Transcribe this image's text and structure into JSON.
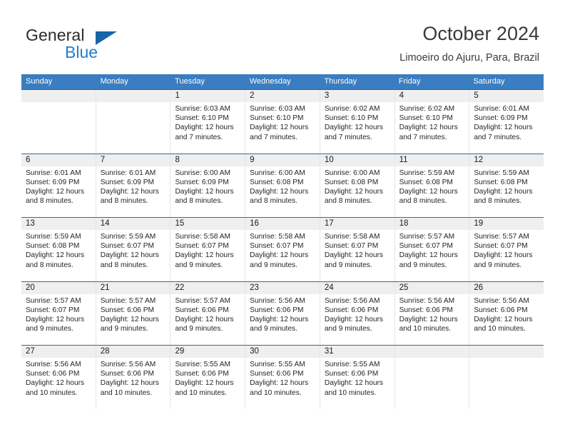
{
  "brand": {
    "word_one": "General",
    "word_two": "Blue",
    "triangle_icon": "triangle-icon",
    "accent_dark": "#1565a8",
    "accent_light": "#1c7fd0"
  },
  "header": {
    "month_title": "October 2024",
    "location": "Limoeiro do Ajuru, Para, Brazil"
  },
  "theme": {
    "header_row_bg": "#3a7dc0",
    "week_divider": "#2d6aa8",
    "day_band_bg": "#efefef",
    "cell_border": "#e6e6e6"
  },
  "weekdays": [
    "Sunday",
    "Monday",
    "Tuesday",
    "Wednesday",
    "Thursday",
    "Friday",
    "Saturday"
  ],
  "weeks": [
    [
      {
        "day": "",
        "empty": true
      },
      {
        "day": "",
        "empty": true
      },
      {
        "day": "1",
        "sunrise": "Sunrise: 6:03 AM",
        "sunset": "Sunset: 6:10 PM",
        "daylight": "Daylight: 12 hours and 7 minutes."
      },
      {
        "day": "2",
        "sunrise": "Sunrise: 6:03 AM",
        "sunset": "Sunset: 6:10 PM",
        "daylight": "Daylight: 12 hours and 7 minutes."
      },
      {
        "day": "3",
        "sunrise": "Sunrise: 6:02 AM",
        "sunset": "Sunset: 6:10 PM",
        "daylight": "Daylight: 12 hours and 7 minutes."
      },
      {
        "day": "4",
        "sunrise": "Sunrise: 6:02 AM",
        "sunset": "Sunset: 6:10 PM",
        "daylight": "Daylight: 12 hours and 7 minutes."
      },
      {
        "day": "5",
        "sunrise": "Sunrise: 6:01 AM",
        "sunset": "Sunset: 6:09 PM",
        "daylight": "Daylight: 12 hours and 7 minutes."
      }
    ],
    [
      {
        "day": "6",
        "sunrise": "Sunrise: 6:01 AM",
        "sunset": "Sunset: 6:09 PM",
        "daylight": "Daylight: 12 hours and 8 minutes."
      },
      {
        "day": "7",
        "sunrise": "Sunrise: 6:01 AM",
        "sunset": "Sunset: 6:09 PM",
        "daylight": "Daylight: 12 hours and 8 minutes."
      },
      {
        "day": "8",
        "sunrise": "Sunrise: 6:00 AM",
        "sunset": "Sunset: 6:09 PM",
        "daylight": "Daylight: 12 hours and 8 minutes."
      },
      {
        "day": "9",
        "sunrise": "Sunrise: 6:00 AM",
        "sunset": "Sunset: 6:08 PM",
        "daylight": "Daylight: 12 hours and 8 minutes."
      },
      {
        "day": "10",
        "sunrise": "Sunrise: 6:00 AM",
        "sunset": "Sunset: 6:08 PM",
        "daylight": "Daylight: 12 hours and 8 minutes."
      },
      {
        "day": "11",
        "sunrise": "Sunrise: 5:59 AM",
        "sunset": "Sunset: 6:08 PM",
        "daylight": "Daylight: 12 hours and 8 minutes."
      },
      {
        "day": "12",
        "sunrise": "Sunrise: 5:59 AM",
        "sunset": "Sunset: 6:08 PM",
        "daylight": "Daylight: 12 hours and 8 minutes."
      }
    ],
    [
      {
        "day": "13",
        "sunrise": "Sunrise: 5:59 AM",
        "sunset": "Sunset: 6:08 PM",
        "daylight": "Daylight: 12 hours and 8 minutes."
      },
      {
        "day": "14",
        "sunrise": "Sunrise: 5:59 AM",
        "sunset": "Sunset: 6:07 PM",
        "daylight": "Daylight: 12 hours and 8 minutes."
      },
      {
        "day": "15",
        "sunrise": "Sunrise: 5:58 AM",
        "sunset": "Sunset: 6:07 PM",
        "daylight": "Daylight: 12 hours and 9 minutes."
      },
      {
        "day": "16",
        "sunrise": "Sunrise: 5:58 AM",
        "sunset": "Sunset: 6:07 PM",
        "daylight": "Daylight: 12 hours and 9 minutes."
      },
      {
        "day": "17",
        "sunrise": "Sunrise: 5:58 AM",
        "sunset": "Sunset: 6:07 PM",
        "daylight": "Daylight: 12 hours and 9 minutes."
      },
      {
        "day": "18",
        "sunrise": "Sunrise: 5:57 AM",
        "sunset": "Sunset: 6:07 PM",
        "daylight": "Daylight: 12 hours and 9 minutes."
      },
      {
        "day": "19",
        "sunrise": "Sunrise: 5:57 AM",
        "sunset": "Sunset: 6:07 PM",
        "daylight": "Daylight: 12 hours and 9 minutes."
      }
    ],
    [
      {
        "day": "20",
        "sunrise": "Sunrise: 5:57 AM",
        "sunset": "Sunset: 6:07 PM",
        "daylight": "Daylight: 12 hours and 9 minutes."
      },
      {
        "day": "21",
        "sunrise": "Sunrise: 5:57 AM",
        "sunset": "Sunset: 6:06 PM",
        "daylight": "Daylight: 12 hours and 9 minutes."
      },
      {
        "day": "22",
        "sunrise": "Sunrise: 5:57 AM",
        "sunset": "Sunset: 6:06 PM",
        "daylight": "Daylight: 12 hours and 9 minutes."
      },
      {
        "day": "23",
        "sunrise": "Sunrise: 5:56 AM",
        "sunset": "Sunset: 6:06 PM",
        "daylight": "Daylight: 12 hours and 9 minutes."
      },
      {
        "day": "24",
        "sunrise": "Sunrise: 5:56 AM",
        "sunset": "Sunset: 6:06 PM",
        "daylight": "Daylight: 12 hours and 9 minutes."
      },
      {
        "day": "25",
        "sunrise": "Sunrise: 5:56 AM",
        "sunset": "Sunset: 6:06 PM",
        "daylight": "Daylight: 12 hours and 10 minutes."
      },
      {
        "day": "26",
        "sunrise": "Sunrise: 5:56 AM",
        "sunset": "Sunset: 6:06 PM",
        "daylight": "Daylight: 12 hours and 10 minutes."
      }
    ],
    [
      {
        "day": "27",
        "sunrise": "Sunrise: 5:56 AM",
        "sunset": "Sunset: 6:06 PM",
        "daylight": "Daylight: 12 hours and 10 minutes."
      },
      {
        "day": "28",
        "sunrise": "Sunrise: 5:56 AM",
        "sunset": "Sunset: 6:06 PM",
        "daylight": "Daylight: 12 hours and 10 minutes."
      },
      {
        "day": "29",
        "sunrise": "Sunrise: 5:55 AM",
        "sunset": "Sunset: 6:06 PM",
        "daylight": "Daylight: 12 hours and 10 minutes."
      },
      {
        "day": "30",
        "sunrise": "Sunrise: 5:55 AM",
        "sunset": "Sunset: 6:06 PM",
        "daylight": "Daylight: 12 hours and 10 minutes."
      },
      {
        "day": "31",
        "sunrise": "Sunrise: 5:55 AM",
        "sunset": "Sunset: 6:06 PM",
        "daylight": "Daylight: 12 hours and 10 minutes."
      },
      {
        "day": "",
        "empty": true
      },
      {
        "day": "",
        "empty": true
      }
    ]
  ]
}
